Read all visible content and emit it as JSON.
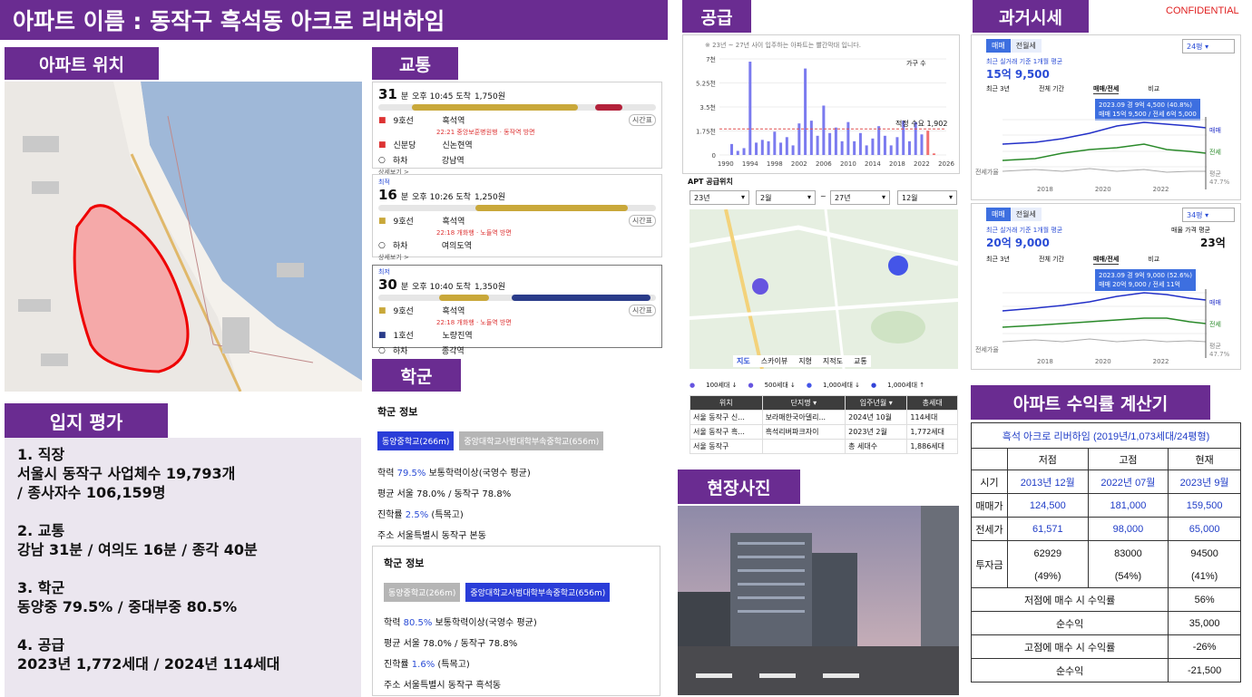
{
  "title": "아파트 이름 : 동작구 흑석동 아크로 리버하임",
  "confidential": "CONFIDENTIAL",
  "sections": {
    "location": "아파트 위치",
    "transit": "교통",
    "school": "학군",
    "eval": "입지 평가",
    "supply": "공급",
    "price": "과거시세",
    "photo": "현장사진",
    "roi": "아파트 수익률 계산기"
  },
  "eval": {
    "items": [
      {
        "head": "1. 직장",
        "lines": [
          "서울시 동작구 사업체수 19,793개",
          "/ 종사자수 106,159명"
        ]
      },
      {
        "head": "2. 교통",
        "lines": [
          "강남 31분 / 여의도 16분 / 종각 40분"
        ]
      },
      {
        "head": "3. 학군",
        "lines": [
          "동양중 79.5% / 중대부중 80.5%"
        ]
      },
      {
        "head": "4. 공급",
        "lines": [
          "2023년 1,772세대 / 2024년 114세대"
        ]
      }
    ]
  },
  "transit": [
    {
      "minutes": "31",
      "unit": "분",
      "info": "오후 10:45 도착",
      "fare": "1,750원",
      "steps": [
        {
          "icon": "subway-icon",
          "line": "9호선",
          "station": "흑석역",
          "sub": "22:21 중앙보훈병원행 · 동작역 방면",
          "badge": "시간표"
        },
        {
          "icon": "subway-icon",
          "line": "신분당",
          "station": "신논현역",
          "sub": "",
          "badge": ""
        },
        {
          "icon": "walk-icon",
          "line": "하차",
          "station": "강남역",
          "sub": "",
          "badge": ""
        }
      ],
      "more": "상세보기 >"
    },
    {
      "label": "최적",
      "minutes": "16",
      "unit": "분",
      "info": "오후 10:26 도착",
      "fare": "1,250원",
      "steps": [
        {
          "icon": "subway-icon",
          "line": "9호선",
          "station": "흑석역",
          "sub": "22:18 개화행 · 노들역 방면",
          "badge": "시간표"
        },
        {
          "icon": "walk-icon",
          "line": "하차",
          "station": "여의도역",
          "sub": "",
          "badge": ""
        }
      ],
      "more": "상세보기 >"
    },
    {
      "label": "최저",
      "minutes": "30",
      "unit": "분",
      "info": "오후 10:40 도착",
      "fare": "1,350원",
      "steps": [
        {
          "icon": "subway-icon",
          "line": "9호선",
          "station": "흑석역",
          "sub": "22:18 개화행 · 노들역 방면",
          "badge": "시간표"
        },
        {
          "icon": "subway-icon",
          "line": "1호선",
          "station": "노량진역",
          "sub": "",
          "badge": ""
        },
        {
          "icon": "walk-icon",
          "line": "하차",
          "station": "종각역",
          "sub": "",
          "badge": ""
        }
      ],
      "more": "상세보기 >"
    }
  ],
  "school": [
    {
      "head": "학군 정보",
      "chips": [
        "동양중학교(266m)",
        "중앙대학교사범대학부속중학교(656m)"
      ],
      "active": 0,
      "rate_label": "학력",
      "rate": "79.5%",
      "rate_desc": "보통학력이상(국영수 평균)",
      "avg": "평균 서울 78.0% / 동작구 78.8%",
      "adv_label": "진학률",
      "adv": "2.5%",
      "adv_desc": "(특목고)",
      "addr": "주소 서울특별시 동작구 본동"
    },
    {
      "head": "학군 정보",
      "chips": [
        "동양중학교(266m)",
        "중앙대학교사범대학부속중학교(656m)"
      ],
      "active": 1,
      "rate_label": "학력",
      "rate": "80.5%",
      "rate_desc": "보통학력이상(국영수 평균)",
      "avg": "평균 서울 78.0% / 동작구 78.8%",
      "adv_label": "진학률",
      "adv": "1.6%",
      "adv_desc": "(특목고)",
      "addr": "주소 서울특별시 동작구 흑석동"
    }
  ],
  "supply": {
    "note": "※ 23년 ~ 27년 사이 입주하는 아파트는 빨간막대 입니다.",
    "legend": "가구 수",
    "avg_label": "적정 수요 1,902",
    "avg_value": 1902,
    "title": "APT 공급위치",
    "filters": [
      "23년",
      "2월",
      "27년",
      "12월"
    ],
    "filter_sep": "~",
    "map_tabs": [
      "지도",
      "스카이뷰",
      "지형",
      "지적도",
      "교통"
    ],
    "map_legend": [
      "100세대 ↓",
      "500세대 ↓",
      "1,000세대 ↓",
      "1,000세대 ↑"
    ],
    "table": {
      "headers": [
        "위치",
        "단지명 ▾",
        "입주년월 ▾",
        "총세대"
      ],
      "rows": [
        [
          "서울 동작구 신...",
          "보라매한국아델리...",
          "2024년 10월",
          "114세대"
        ],
        [
          "서울 동작구 흑...",
          "흑석리버파크자이",
          "2023년 2월",
          "1,772세대"
        ],
        [
          "서울 동작구",
          "",
          "총 세대수",
          "1,886세대"
        ]
      ]
    }
  },
  "price": [
    {
      "tabs": [
        "매매",
        "전월세"
      ],
      "size": "24평 ▾",
      "sub": "최근 실거래 기준 1개월 평균",
      "value": "15억 9,500",
      "range_tabs": [
        "최근 3년",
        "전체 기간",
        "매매/전세",
        "비교"
      ],
      "tooltip": [
        "2023.09 경 9억 4,500 (40.8%)",
        "매매 15억 9,500 / 전세 6억 5,000"
      ],
      "legend": [
        "매매",
        "전세",
        "평균 47.7%"
      ],
      "rate_label": "전세가율",
      "years": [
        "2018",
        "2020",
        "2022"
      ]
    },
    {
      "tabs": [
        "매매",
        "전월세"
      ],
      "size": "34평 ▾",
      "sub": "최근 실거래 기준 1개월 평균",
      "value": "20억 9,000",
      "extra_label": "매물 가격 평균",
      "extra_value": "23억",
      "range_tabs": [
        "최근 3년",
        "전체 기간",
        "매매/전세",
        "비교"
      ],
      "tooltip": [
        "2023.09 경 9억 9,000 (52.6%)",
        "매매 20억 9,000 / 전세 11억"
      ],
      "legend": [
        "매매",
        "전세",
        "평균 47.7%"
      ],
      "rate_label": "전세가율",
      "years": [
        "2018",
        "2020",
        "2022"
      ]
    }
  ],
  "roi": {
    "title": "흑석 아크로 리버하임 (2019년/1,073세대/24평형)",
    "headers": [
      "",
      "저점",
      "고점",
      "현재"
    ],
    "rows": [
      {
        "label": "시기",
        "vals": [
          "2013년 12월",
          "2022년 07월",
          "2023년 9월"
        ]
      },
      {
        "label": "매매가",
        "vals": [
          "124,500",
          "181,000",
          "159,500"
        ]
      },
      {
        "label": "전세가",
        "vals": [
          "61,571",
          "98,000",
          "65,000"
        ]
      },
      {
        "label": "투자금",
        "vals": [
          "62929",
          "83000",
          "94500"
        ]
      },
      {
        "label": "",
        "vals": [
          "(49%)",
          "(54%)",
          "(41%)"
        ]
      }
    ],
    "summary": [
      {
        "label": "저점에 매수 시 수익률",
        "value": "56%"
      },
      {
        "label": "순수익",
        "value": "35,000"
      },
      {
        "label": "고점에 매수 시 수익률",
        "value": "-26%"
      },
      {
        "label": "순수익",
        "value": "-21,500"
      }
    ]
  },
  "chart_data": {
    "type": "bar",
    "x": [
      1991,
      1992,
      1993,
      1994,
      1995,
      1996,
      1997,
      1998,
      1999,
      2000,
      2001,
      2002,
      2003,
      2004,
      2005,
      2006,
      2007,
      2008,
      2009,
      2010,
      2011,
      2012,
      2013,
      2014,
      2015,
      2016,
      2017,
      2018,
      2019,
      2020,
      2021,
      2022,
      2023,
      2024
    ],
    "values": [
      800,
      300,
      500,
      6800,
      900,
      1100,
      1000,
      1700,
      900,
      1300,
      700,
      2300,
      6300,
      2500,
      1400,
      3600,
      1600,
      2000,
      1000,
      2400,
      1000,
      1600,
      700,
      1200,
      2100,
      1400,
      700,
      1300,
      2500,
      1000,
      2400,
      1500,
      1772,
      114
    ],
    "highlight_from": 2023,
    "xticks": [
      "1990",
      "1994",
      "1998",
      "2002",
      "2006",
      "2010",
      "2014",
      "2018",
      "2022",
      "2026"
    ],
    "yticks": [
      "0",
      "1.75천",
      "3.5천",
      "5.25천",
      "7천"
    ],
    "ylim": [
      0,
      7000
    ],
    "xlim": [
      1989,
      2026
    ],
    "colors": {
      "bar": "#7b7bef",
      "highlight": "#f07070",
      "avg": "#e05050"
    }
  }
}
